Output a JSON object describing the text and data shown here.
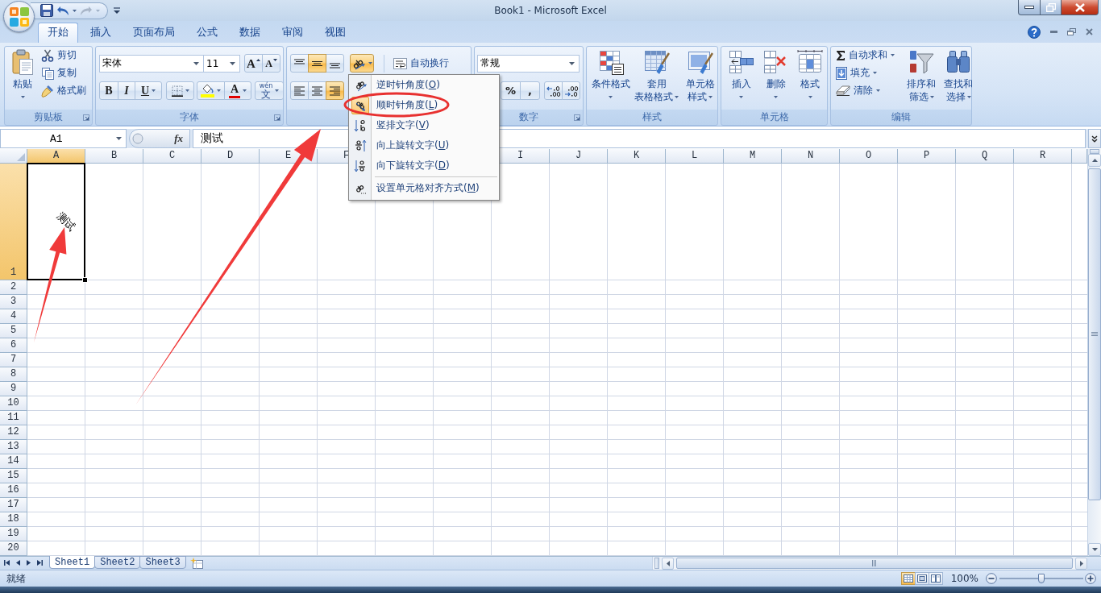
{
  "window": {
    "title": "Book1 - Microsoft Excel"
  },
  "tabs": [
    {
      "label": "开始",
      "selected": true
    },
    {
      "label": "插入",
      "selected": false
    },
    {
      "label": "页面布局",
      "selected": false
    },
    {
      "label": "公式",
      "selected": false
    },
    {
      "label": "数据",
      "selected": false
    },
    {
      "label": "审阅",
      "selected": false
    },
    {
      "label": "视图",
      "selected": false
    }
  ],
  "clipboard": {
    "label": "剪贴板",
    "paste": "粘贴",
    "commands": [
      {
        "kind": "cut",
        "label": "剪切"
      },
      {
        "kind": "copy",
        "label": "复制"
      },
      {
        "kind": "format_painter",
        "label": "格式刷"
      }
    ]
  },
  "font": {
    "label": "字体",
    "font_name": "宋体",
    "font_size": "11",
    "grow": "A",
    "shrink": "A",
    "bold": "B",
    "italic": "I",
    "underline": "U",
    "font_color": "A",
    "phonetic_top": "wén",
    "phonetic_bottom": "文"
  },
  "alignment": {
    "vertical": [
      {
        "kind": "top",
        "selected": false
      },
      {
        "kind": "middle",
        "selected": true
      },
      {
        "kind": "bottom",
        "selected": false
      }
    ],
    "orientation_expanded": true,
    "wrap_text": "自动换行",
    "horizontal": [
      {
        "kind": "left",
        "selected": false
      },
      {
        "kind": "center",
        "selected": false
      },
      {
        "kind": "right",
        "selected": true
      }
    ]
  },
  "orientation_menu": [
    {
      "kind": "counterclockwise",
      "label": "逆时针角度(",
      "key": "O",
      "end": ")",
      "selected": false
    },
    {
      "kind": "clockwise",
      "label": "顺时针角度(",
      "key": "L",
      "end": ")",
      "selected": true
    },
    {
      "kind": "vertical",
      "label": "竖排文字(",
      "key": "V",
      "end": ")",
      "selected": false
    },
    {
      "kind": "rotate_up",
      "label": "向上旋转文字(",
      "key": "U",
      "end": ")",
      "selected": false
    },
    {
      "kind": "rotate_down",
      "label": "向下旋转文字(",
      "key": "D",
      "end": ")",
      "selected": false
    },
    {
      "kind": "separator"
    },
    {
      "kind": "format_alignment",
      "label": "设置单元格对齐方式(",
      "key": "M",
      "end": ")",
      "selected": false
    }
  ],
  "number": {
    "label": "数字",
    "format": "常规",
    "percent": "%",
    "comma": ","
  },
  "styles": {
    "label": "样式",
    "buttons": [
      {
        "kind": "conditional_formatting",
        "lines": [
          "条件格式"
        ]
      },
      {
        "kind": "format_as_table",
        "lines": [
          "套用",
          "表格格式"
        ]
      },
      {
        "kind": "cell_styles",
        "lines": [
          "单元格",
          "样式"
        ]
      }
    ]
  },
  "cells": {
    "label": "单元格",
    "buttons": [
      {
        "kind": "insert",
        "lines": [
          "插入"
        ]
      },
      {
        "kind": "delete",
        "lines": [
          "删除"
        ]
      },
      {
        "kind": "format",
        "lines": [
          "格式"
        ]
      }
    ]
  },
  "editing": {
    "label": "编辑",
    "commands": [
      {
        "kind": "autosum",
        "label": "自动求和"
      },
      {
        "kind": "fill",
        "label": "填充"
      },
      {
        "kind": "clear",
        "label": "清除"
      }
    ],
    "buttons": [
      {
        "kind": "sort_filter",
        "lines": [
          "排序和",
          "筛选"
        ]
      },
      {
        "kind": "find_select",
        "lines": [
          "查找和",
          "选择"
        ]
      }
    ]
  },
  "formula_bar": {
    "name_box": "A1",
    "function_button": "fx",
    "formula": "测试"
  },
  "columns": [
    {
      "label": "A",
      "selected": true
    },
    {
      "label": "B",
      "selected": false
    },
    {
      "label": "C",
      "selected": false
    },
    {
      "label": "D",
      "selected": false
    },
    {
      "label": "E",
      "selected": false
    },
    {
      "label": "F",
      "selected": false
    },
    null,
    null,
    {
      "label": "I",
      "selected": false
    },
    {
      "label": "J",
      "selected": false
    },
    {
      "label": "K",
      "selected": false
    },
    {
      "label": "L",
      "selected": false
    },
    {
      "label": "M",
      "selected": false
    },
    {
      "label": "N",
      "selected": false
    },
    {
      "label": "O",
      "selected": false
    },
    {
      "label": "P",
      "selected": false
    },
    {
      "label": "Q",
      "selected": false
    },
    {
      "label": "R",
      "selected": false
    }
  ],
  "rows": [
    {
      "label": "1",
      "selected": true,
      "cells": [
        {
          "text": "测试",
          "rotated": true,
          "active": true
        }
      ]
    },
    {
      "label": "2",
      "selected": false
    },
    {
      "label": "3",
      "selected": false
    },
    {
      "label": "4",
      "selected": false
    },
    {
      "label": "5",
      "selected": false
    },
    {
      "label": "6",
      "selected": false
    },
    {
      "label": "7",
      "selected": false
    },
    {
      "label": "8",
      "selected": false
    },
    {
      "label": "9",
      "selected": false
    },
    {
      "label": "10",
      "selected": false
    },
    {
      "label": "11",
      "selected": false
    },
    {
      "label": "12",
      "selected": false
    },
    {
      "label": "13",
      "selected": false
    },
    {
      "label": "14",
      "selected": false
    },
    {
      "label": "15",
      "selected": false
    },
    {
      "label": "16",
      "selected": false
    },
    {
      "label": "17",
      "selected": false
    },
    {
      "label": "18",
      "selected": false
    },
    {
      "label": "19",
      "selected": false
    },
    {
      "label": "20",
      "selected": false
    }
  ],
  "sheet_tabs": [
    {
      "label": "Sheet1",
      "selected": true
    },
    {
      "label": "Sheet2",
      "selected": false
    },
    {
      "label": "Sheet3",
      "selected": false
    }
  ],
  "status_bar": {
    "status": "就绪",
    "views": [
      {
        "kind": "normal",
        "selected": true
      },
      {
        "kind": "page_layout",
        "selected": false
      },
      {
        "kind": "page_break_preview",
        "selected": false
      }
    ],
    "zoom": "100%",
    "zoom_slider": {
      "level": 0.5
    }
  },
  "annotations": [
    {
      "kind": "arrow"
    },
    {
      "kind": "arrow"
    },
    {
      "kind": "ellipse"
    }
  ]
}
